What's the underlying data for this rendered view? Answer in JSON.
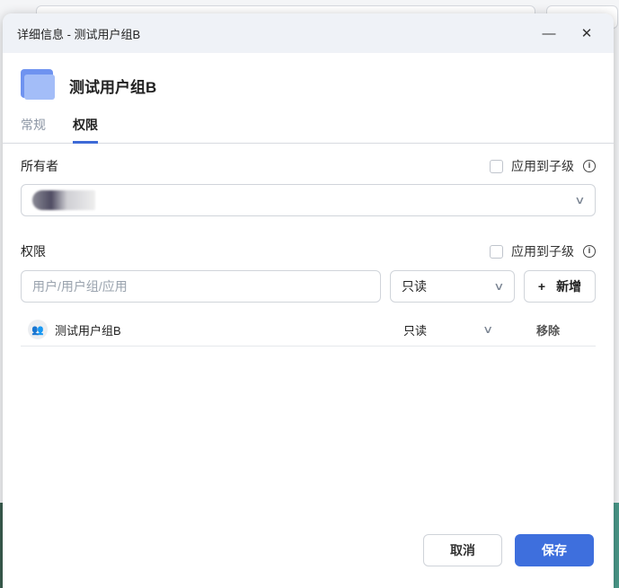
{
  "dialog": {
    "title": "详细信息 - 测试用户组B",
    "name": "测试用户组B"
  },
  "tabs": [
    {
      "label": "常规"
    },
    {
      "label": "权限"
    }
  ],
  "owner": {
    "label": "所有者",
    "apply_children": "应用到子级"
  },
  "permissions": {
    "label": "权限",
    "apply_children": "应用到子级",
    "input_placeholder": "用户/用户组/应用",
    "perm_select": "只读",
    "add_label": "新增",
    "entries": [
      {
        "name": "测试用户组B",
        "permission": "只读",
        "remove": "移除"
      }
    ]
  },
  "footer": {
    "cancel": "取消",
    "save": "保存"
  },
  "colors": {
    "accent": "#3e6fdd"
  }
}
